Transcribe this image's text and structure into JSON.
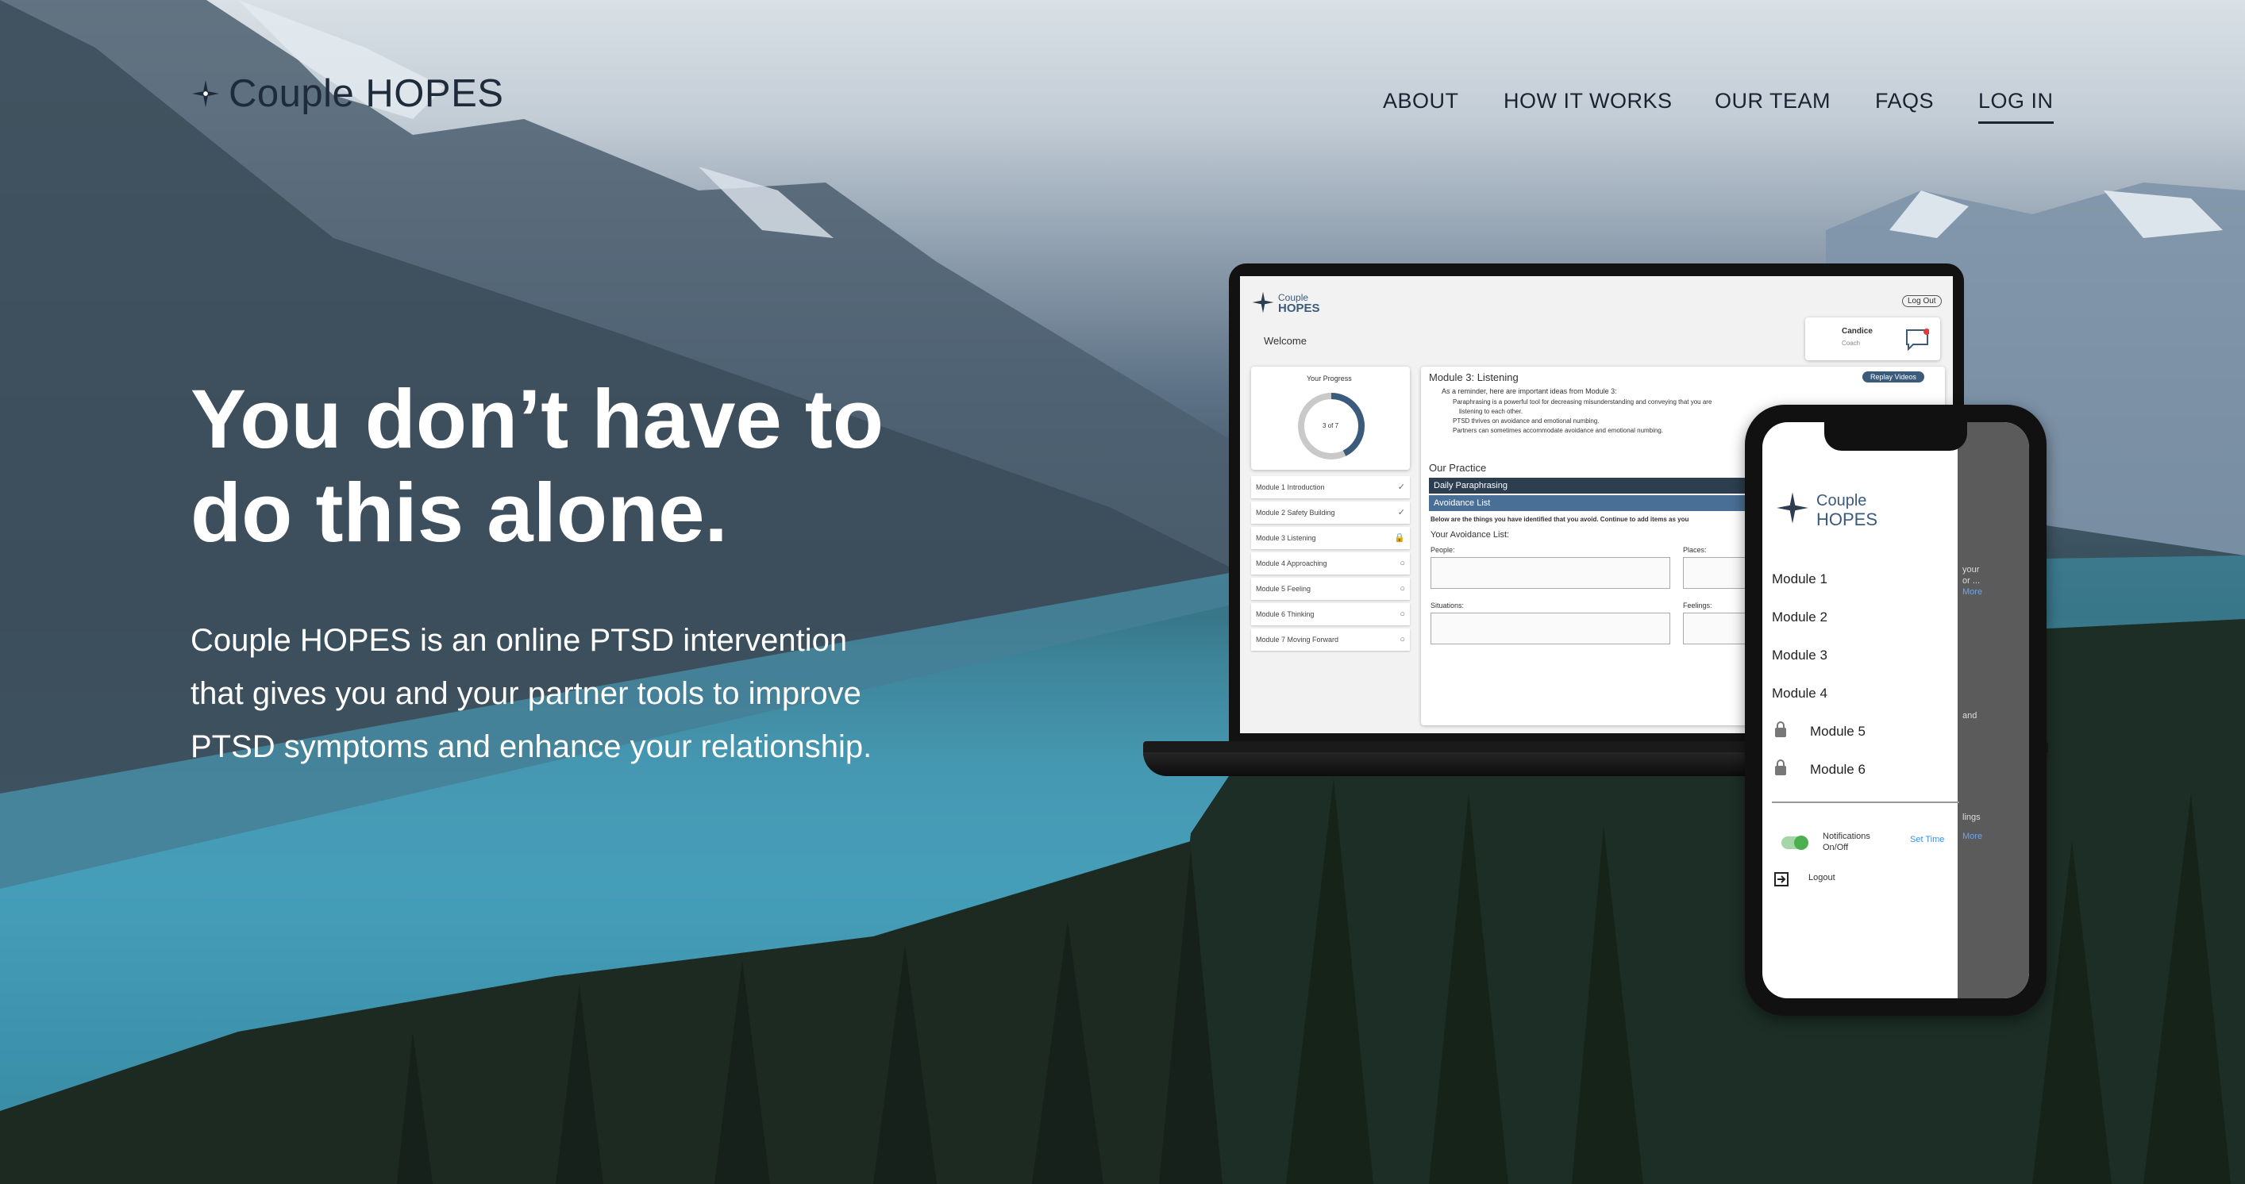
{
  "brand": {
    "name": "Couple HOPES",
    "logo_icon": "star-flower-icon"
  },
  "nav": {
    "items": [
      {
        "label": "ABOUT"
      },
      {
        "label": "HOW IT WORKS"
      },
      {
        "label": "OUR TEAM"
      },
      {
        "label": "FAQS"
      },
      {
        "label": "LOG IN"
      }
    ],
    "active": "LOG IN"
  },
  "hero": {
    "headline_line1": "You don’t have to",
    "headline_line2": "do this alone.",
    "description": "Couple HOPES is an online PTSD intervention that gives you and your partner tools to improve PTSD symptoms and enhance your relationship."
  },
  "laptop_app": {
    "logo_line1": "Couple",
    "logo_line2": "HOPES",
    "logout_label": "Log Out",
    "welcome": "Welcome",
    "user_name": "Candice",
    "user_role": "Coach",
    "progress_title": "Your Progress",
    "progress_text": "3 of 7",
    "modules": [
      {
        "label": "Module 1 Introduction",
        "status": "✓"
      },
      {
        "label": "Module 2 Safety Building",
        "status": "✓"
      },
      {
        "label": "Module 3 Listening",
        "status": "🔒"
      },
      {
        "label": "Module 4 Approaching",
        "status": "○"
      },
      {
        "label": "Module 5 Feeling",
        "status": "○"
      },
      {
        "label": "Module 6 Thinking",
        "status": "○"
      },
      {
        "label": "Module 7 Moving Forward",
        "status": "○"
      }
    ],
    "module_title": "Module 3: Listening",
    "replay_label": "Replay Videos",
    "intro": "As a reminder, here are important ideas from Module 3:",
    "bullets": [
      "Paraphrasing is a powerful tool for decreasing misunderstanding and conveying that you are",
      "listening to each other.",
      "PTSD thrives on avoidance and emotional numbing.",
      "Partners can sometimes accommodate avoidance and emotional numbing."
    ],
    "practice_title": "Our Practice",
    "practice_items": [
      "Daily Paraphrasing",
      "Avoidance List"
    ],
    "avoid_note": "Below are the things you have identified that you avoid. Continue to add items as you",
    "avoid_title": "Your Avoidance List:",
    "fields": [
      "People:",
      "Places:",
      "Situations:",
      "Feelings:"
    ]
  },
  "phone_app": {
    "logo_line1": "Couple",
    "logo_line2": "HOPES",
    "menu": [
      {
        "label": "Module 1",
        "locked": false
      },
      {
        "label": "Module 2",
        "locked": false
      },
      {
        "label": "Module 3",
        "locked": false
      },
      {
        "label": "Module 4",
        "locked": false
      },
      {
        "label": "Module 5",
        "locked": true
      },
      {
        "label": "Module 6",
        "locked": true
      }
    ],
    "notifications_label_1": "Notifications",
    "notifications_label_2": "On/Off",
    "set_time": "Set Time",
    "logout": "Logout",
    "peek_text_1": "your",
    "peek_text_2": "or ...",
    "peek_more_1": "More",
    "peek_text_3": "and",
    "peek_text_4": "lings",
    "peek_more_2": "More"
  },
  "colors": {
    "nav_text": "#1b2230",
    "headline": "#ffffff",
    "app_accent": "#3b5b7c",
    "app_dark": "#2c3e50",
    "toggle_green": "#4caf50",
    "link_blue": "#3a8ee6"
  }
}
